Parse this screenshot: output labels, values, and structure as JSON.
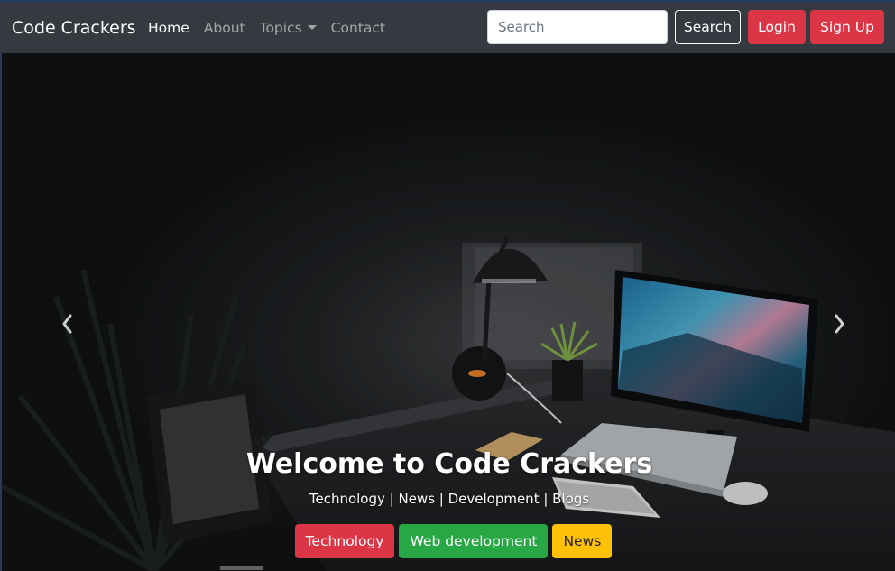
{
  "navbar": {
    "brand": "Code Crackers",
    "links": [
      {
        "label": "Home",
        "active": true
      },
      {
        "label": "About",
        "active": false
      },
      {
        "label": "Topics",
        "active": false,
        "dropdown": true
      },
      {
        "label": "Contact",
        "active": false
      }
    ],
    "search": {
      "placeholder": "Search",
      "value": "",
      "button_label": "Search"
    },
    "login_label": "Login",
    "signup_label": "Sign Up"
  },
  "hero": {
    "title": "Welcome to Code Crackers",
    "subtitle": "Technology | News | Development | Blogs",
    "tags": [
      {
        "label": "Technology",
        "color": "#dc3545"
      },
      {
        "label": "Web development",
        "color": "#28a745"
      },
      {
        "label": "News",
        "color": "#ffc107"
      }
    ],
    "prev_icon": "chevron-left-icon",
    "next_icon": "chevron-right-icon"
  },
  "colors": {
    "navbar_bg": "#343a40",
    "danger": "#dc3545",
    "success": "#28a745",
    "warning": "#ffc107"
  }
}
